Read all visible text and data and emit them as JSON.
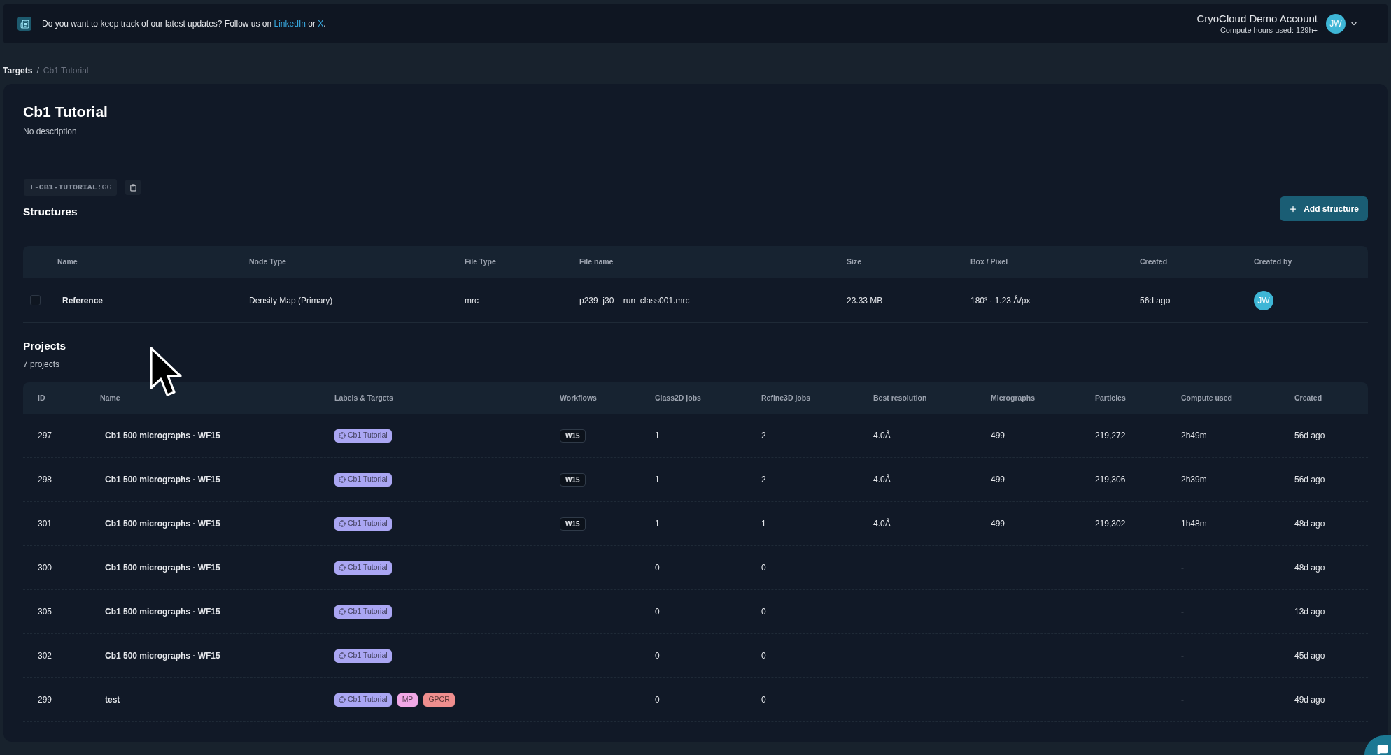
{
  "announcement": {
    "parts": [
      {
        "kind": "text",
        "text": "Do you want to keep track of our latest updates? Follow us on "
      },
      {
        "kind": "link",
        "text": "LinkedIn"
      },
      {
        "kind": "text",
        "text": " or "
      },
      {
        "kind": "link",
        "text": "X"
      },
      {
        "kind": "text",
        "text": "."
      }
    ]
  },
  "account": {
    "name": "CryoCloud Demo Account",
    "compute_hours": "Compute hours used: 129h+",
    "initials": "JW"
  },
  "breadcrumb": {
    "separator": "/",
    "items": [
      {
        "label": "Targets",
        "selected": false
      },
      {
        "label": "Cb1 Tutorial",
        "selected": true
      }
    ]
  },
  "target": {
    "title": "Cb1 Tutorial",
    "description": "No description",
    "code": "T-**CB1-TUTORIAL**:GG"
  },
  "structures": {
    "title": "Structures",
    "add_button": "Add structure",
    "columns": [
      "Name",
      "Node Type",
      "File Type",
      "File name",
      "Size",
      "Box / Pixel",
      "Created",
      "Created by"
    ],
    "rows": [
      {
        "checked": false,
        "name": "Reference",
        "node_type": "Density Map (Primary)",
        "file_type": "mrc",
        "file_name": "p239_j30__run_class001.mrc",
        "size": "23.33 MB",
        "box_pixel": "180³ · 1.23 Å/px",
        "created": "56d ago",
        "created_by": "JW"
      }
    ]
  },
  "projects": {
    "title": "Projects",
    "count": "7 projects",
    "columns": [
      "ID",
      "Name",
      "Labels & Targets",
      "Workflows",
      "Class2D jobs",
      "Refine3D jobs",
      "Best resolution",
      "Micrographs",
      "Particles",
      "Compute used",
      "Created"
    ],
    "rows": [
      {
        "id": "297",
        "name": "Cb1 500 micrographs - WF15",
        "labels": [
          {
            "kind": "target",
            "text": "Cb1 Tutorial",
            "color": "#aaa6f3"
          }
        ],
        "workflows": [
          {
            "kind": "badge",
            "text": "W15"
          }
        ],
        "class2d_jobs": "1",
        "refine3d_jobs": "2",
        "best_resolution": "4.0Å",
        "micrographs": "499",
        "particles": "219,272",
        "compute_used": "2h49m",
        "created": "56d ago"
      },
      {
        "id": "298",
        "name": "Cb1 500 micrographs - WF15",
        "labels": [
          {
            "kind": "target",
            "text": "Cb1 Tutorial",
            "color": "#aaa6f3"
          }
        ],
        "workflows": [
          {
            "kind": "badge",
            "text": "W15"
          }
        ],
        "class2d_jobs": "1",
        "refine3d_jobs": "2",
        "best_resolution": "4.0Å",
        "micrographs": "499",
        "particles": "219,306",
        "compute_used": "2h39m",
        "created": "56d ago"
      },
      {
        "id": "301",
        "name": "Cb1 500 micrographs - WF15",
        "labels": [
          {
            "kind": "target",
            "text": "Cb1 Tutorial",
            "color": "#aaa6f3"
          }
        ],
        "workflows": [
          {
            "kind": "badge",
            "text": "W15"
          }
        ],
        "class2d_jobs": "1",
        "refine3d_jobs": "1",
        "best_resolution": "4.0Å",
        "micrographs": "499",
        "particles": "219,302",
        "compute_used": "1h48m",
        "created": "48d ago"
      },
      {
        "id": "300",
        "name": "Cb1 500 micrographs - WF15",
        "labels": [
          {
            "kind": "target",
            "text": "Cb1 Tutorial",
            "color": "#aaa6f3"
          }
        ],
        "workflows": [
          {
            "kind": "none",
            "text": "—"
          }
        ],
        "class2d_jobs": "0",
        "refine3d_jobs": "0",
        "best_resolution": "–",
        "micrographs": "—",
        "particles": "—",
        "compute_used": "-",
        "created": "48d ago"
      },
      {
        "id": "305",
        "name": "Cb1 500 micrographs - WF15",
        "labels": [
          {
            "kind": "target",
            "text": "Cb1 Tutorial",
            "color": "#aaa6f3"
          }
        ],
        "workflows": [
          {
            "kind": "none",
            "text": "—"
          }
        ],
        "class2d_jobs": "0",
        "refine3d_jobs": "0",
        "best_resolution": "–",
        "micrographs": "—",
        "particles": "—",
        "compute_used": "-",
        "created": "13d ago"
      },
      {
        "id": "302",
        "name": "Cb1 500 micrographs - WF15",
        "labels": [
          {
            "kind": "target",
            "text": "Cb1 Tutorial",
            "color": "#aaa6f3"
          }
        ],
        "workflows": [
          {
            "kind": "none",
            "text": "—"
          }
        ],
        "class2d_jobs": "0",
        "refine3d_jobs": "0",
        "best_resolution": "–",
        "micrographs": "—",
        "particles": "—",
        "compute_used": "-",
        "created": "45d ago"
      },
      {
        "id": "299",
        "name": "test",
        "labels": [
          {
            "kind": "target",
            "text": "Cb1 Tutorial",
            "color": "#aaa6f3"
          },
          {
            "kind": "label",
            "text": "MP",
            "color": "#f1a8e6"
          },
          {
            "kind": "label",
            "text": "GPCR",
            "color": "#ef8e8e"
          }
        ],
        "workflows": [
          {
            "kind": "none",
            "text": "—"
          }
        ],
        "class2d_jobs": "0",
        "refine3d_jobs": "0",
        "best_resolution": "–",
        "micrographs": "—",
        "particles": "—",
        "compute_used": "-",
        "created": "49d ago"
      }
    ]
  }
}
